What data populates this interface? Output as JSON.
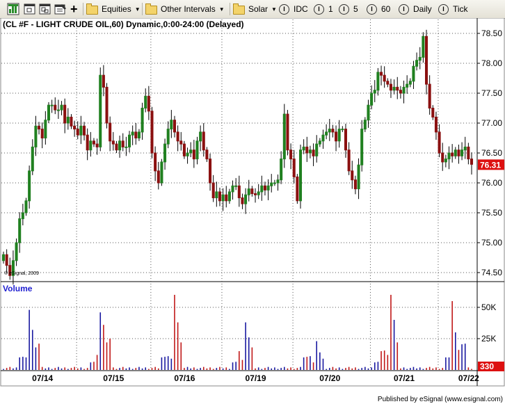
{
  "toolbar": {
    "equities": "Equities",
    "other_intervals": "Other Intervals",
    "solar": "Solar",
    "idc": "IDC",
    "i1": "1",
    "i5": "5",
    "i60": "60",
    "daily": "Daily",
    "tick": "Tick"
  },
  "chart_title": "(CL #F - LIGHT CRUDE OIL,60) Dynamic,0:00-24:00 (Delayed)",
  "copyright": "© eSignal, 2009",
  "volume_label": "Volume",
  "footer": "Published by eSignal (www.esignal.com)",
  "last_price": "76.31",
  "last_volume": "330",
  "colors": {
    "up": "#208020",
    "down": "#8b1010",
    "vol_up": "#1818a0",
    "vol_down": "#c01818",
    "last_price_bg": "#dd1010"
  },
  "chart_data": [
    {
      "type": "candlestick",
      "title": "(CL #F - LIGHT CRUDE OIL,60) Dynamic,0:00-24:00 (Delayed)",
      "xlabel": "",
      "ylabel": "",
      "ylim": [
        74.2,
        78.65
      ],
      "yticks": [
        "74.50",
        "75.00",
        "75.50",
        "76.00",
        "76.50",
        "77.00",
        "77.50",
        "78.00",
        "78.50"
      ],
      "x_date_labels": [
        "07/14",
        "07/15",
        "07/16",
        "07/19",
        "07/20",
        "07/21",
        "07/22"
      ],
      "grid": true,
      "last_value": 76.31,
      "closes": [
        74.8,
        74.62,
        74.45,
        74.7,
        75.0,
        75.4,
        75.5,
        75.7,
        76.2,
        76.6,
        76.95,
        76.9,
        76.75,
        77.05,
        77.3,
        77.3,
        77.22,
        77.22,
        77.3,
        77.0,
        77.1,
        76.95,
        76.9,
        76.8,
        76.95,
        76.8,
        76.55,
        76.7,
        76.65,
        76.6,
        77.8,
        77.6,
        77.0,
        76.7,
        76.65,
        76.55,
        76.7,
        76.6,
        76.6,
        76.8,
        76.85,
        76.75,
        76.85,
        77.25,
        77.45,
        77.2,
        76.5,
        76.2,
        76.0,
        76.35,
        76.65,
        76.9,
        77.05,
        76.85,
        76.7,
        76.65,
        76.45,
        76.5,
        76.55,
        76.4,
        76.7,
        76.85,
        76.55,
        76.4,
        76.0,
        75.75,
        75.85,
        75.7,
        75.8,
        75.7,
        75.85,
        75.95,
        75.95,
        75.75,
        75.65,
        75.8,
        75.9,
        75.82,
        75.8,
        75.85,
        75.95,
        75.88,
        75.95,
        76.0,
        76.0,
        76.05,
        76.4,
        77.15,
        76.55,
        76.4,
        76.1,
        75.7,
        76.55,
        76.6,
        76.5,
        76.55,
        76.45,
        76.65,
        76.7,
        76.8,
        76.85,
        76.9,
        76.85,
        76.7,
        76.9,
        76.9,
        76.55,
        76.2,
        76.05,
        75.9,
        76.3,
        76.9,
        77.05,
        77.3,
        77.5,
        77.55,
        77.85,
        77.8,
        77.7,
        77.65,
        77.55,
        77.6,
        77.55,
        77.5,
        77.6,
        77.65,
        77.7,
        77.95,
        78.05,
        78.1,
        78.45,
        77.65,
        77.25,
        77.1,
        76.85,
        76.5,
        76.35,
        76.4,
        76.5,
        76.45,
        76.55,
        76.45,
        76.55,
        76.6,
        76.4,
        76.31
      ]
    },
    {
      "type": "bar",
      "title": "Volume",
      "ylim": [
        0,
        70000
      ],
      "yticks": [
        "25K",
        "50K"
      ],
      "last_value": 330
    }
  ]
}
